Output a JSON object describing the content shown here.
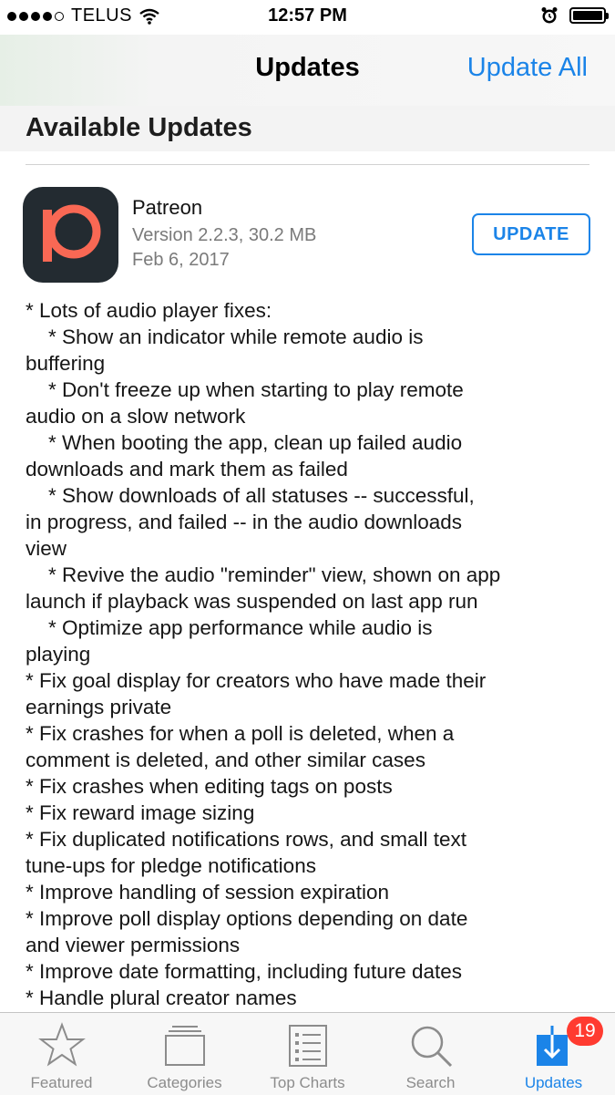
{
  "status_bar": {
    "carrier": "TELUS",
    "time": "12:57 PM",
    "signal_icon": "signal-dots-icon",
    "wifi_icon": "wifi-icon",
    "alarm_icon": "alarm-clock-icon",
    "battery_icon": "battery-icon"
  },
  "nav": {
    "title": "Updates",
    "update_all_label": "Update All"
  },
  "section": {
    "title": "Available Updates"
  },
  "app": {
    "name": "Patreon",
    "version": "Version 2.2.3, 30.2 MB",
    "date": "Feb 6, 2017",
    "update_label": "UPDATE",
    "icon": "patreon-logo-icon"
  },
  "notes": [
    "* Lots of audio player fixes:",
    "    * Show an indicator while remote audio is",
    "buffering",
    "    * Don't freeze up when starting to play remote",
    "audio on a slow network",
    "    * When booting the app, clean up failed audio",
    "downloads and mark them as failed",
    "    * Show downloads of all statuses -- successful,",
    "in progress, and failed -- in the audio downloads",
    "view",
    "    * Revive the audio \"reminder\" view, shown on app",
    "launch if playback was suspended on last app run",
    "    * Optimize app performance while audio is",
    "playing",
    "* Fix goal display for creators who have made their",
    "earnings private",
    "* Fix crashes for when a poll is deleted, when a",
    "comment is deleted, and other similar cases",
    "* Fix crashes when editing tags on posts",
    "* Fix reward image sizing",
    "* Fix duplicated notifications rows, and small text",
    "tune-ups for pledge notifications",
    "* Improve handling of session expiration",
    "* Improve poll display options depending on date",
    "and viewer permissions",
    "* Improve date formatting, including future dates",
    "* Handle plural creator names"
  ],
  "tabs": [
    {
      "label": "Featured",
      "icon": "star-icon"
    },
    {
      "label": "Categories",
      "icon": "stacked-cards-icon"
    },
    {
      "label": "Top Charts",
      "icon": "list-icon"
    },
    {
      "label": "Search",
      "icon": "magnifier-icon"
    },
    {
      "label": "Updates",
      "icon": "download-arrow-icon",
      "badge": "19",
      "active": true
    }
  ],
  "colors": {
    "accent": "#1b84e8",
    "badge": "#ff3b30",
    "patreon": "#f96854"
  }
}
